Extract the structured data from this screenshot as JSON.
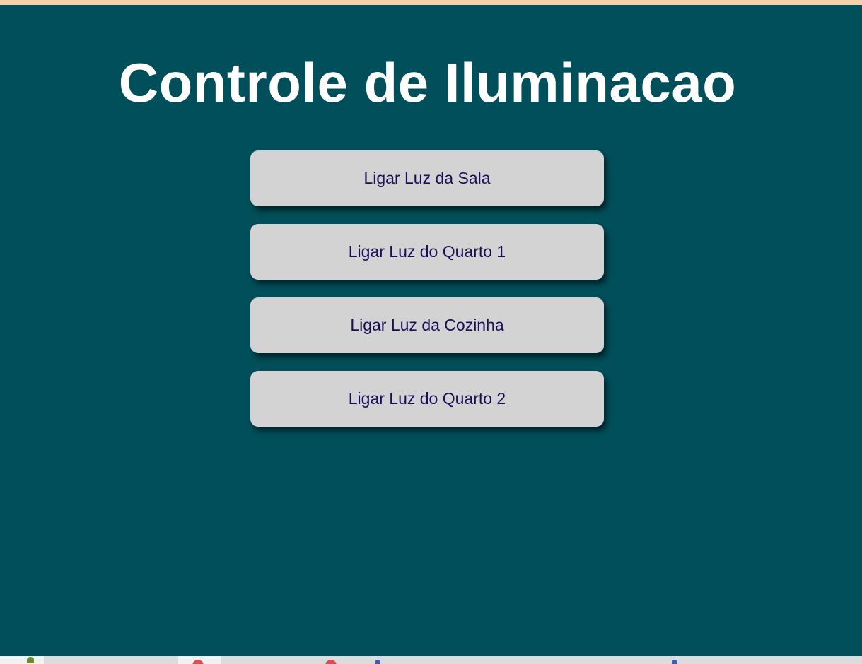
{
  "page": {
    "title": "Controle de Iluminacao"
  },
  "buttons": [
    {
      "label": "Ligar Luz da Sala"
    },
    {
      "label": "Ligar Luz do Quarto 1"
    },
    {
      "label": "Ligar Luz da Cozinha"
    },
    {
      "label": "Ligar Luz do Quarto 2"
    }
  ],
  "colors": {
    "background": "#004f5a",
    "button_background": "#d3d3d3",
    "button_text": "#1a0f57",
    "title_text": "#ffffff",
    "top_strip": "#f6d2a8"
  },
  "taskbar": {
    "icons": [
      "app-icon",
      "browser-icon",
      "search-icon",
      "user-icon"
    ]
  }
}
